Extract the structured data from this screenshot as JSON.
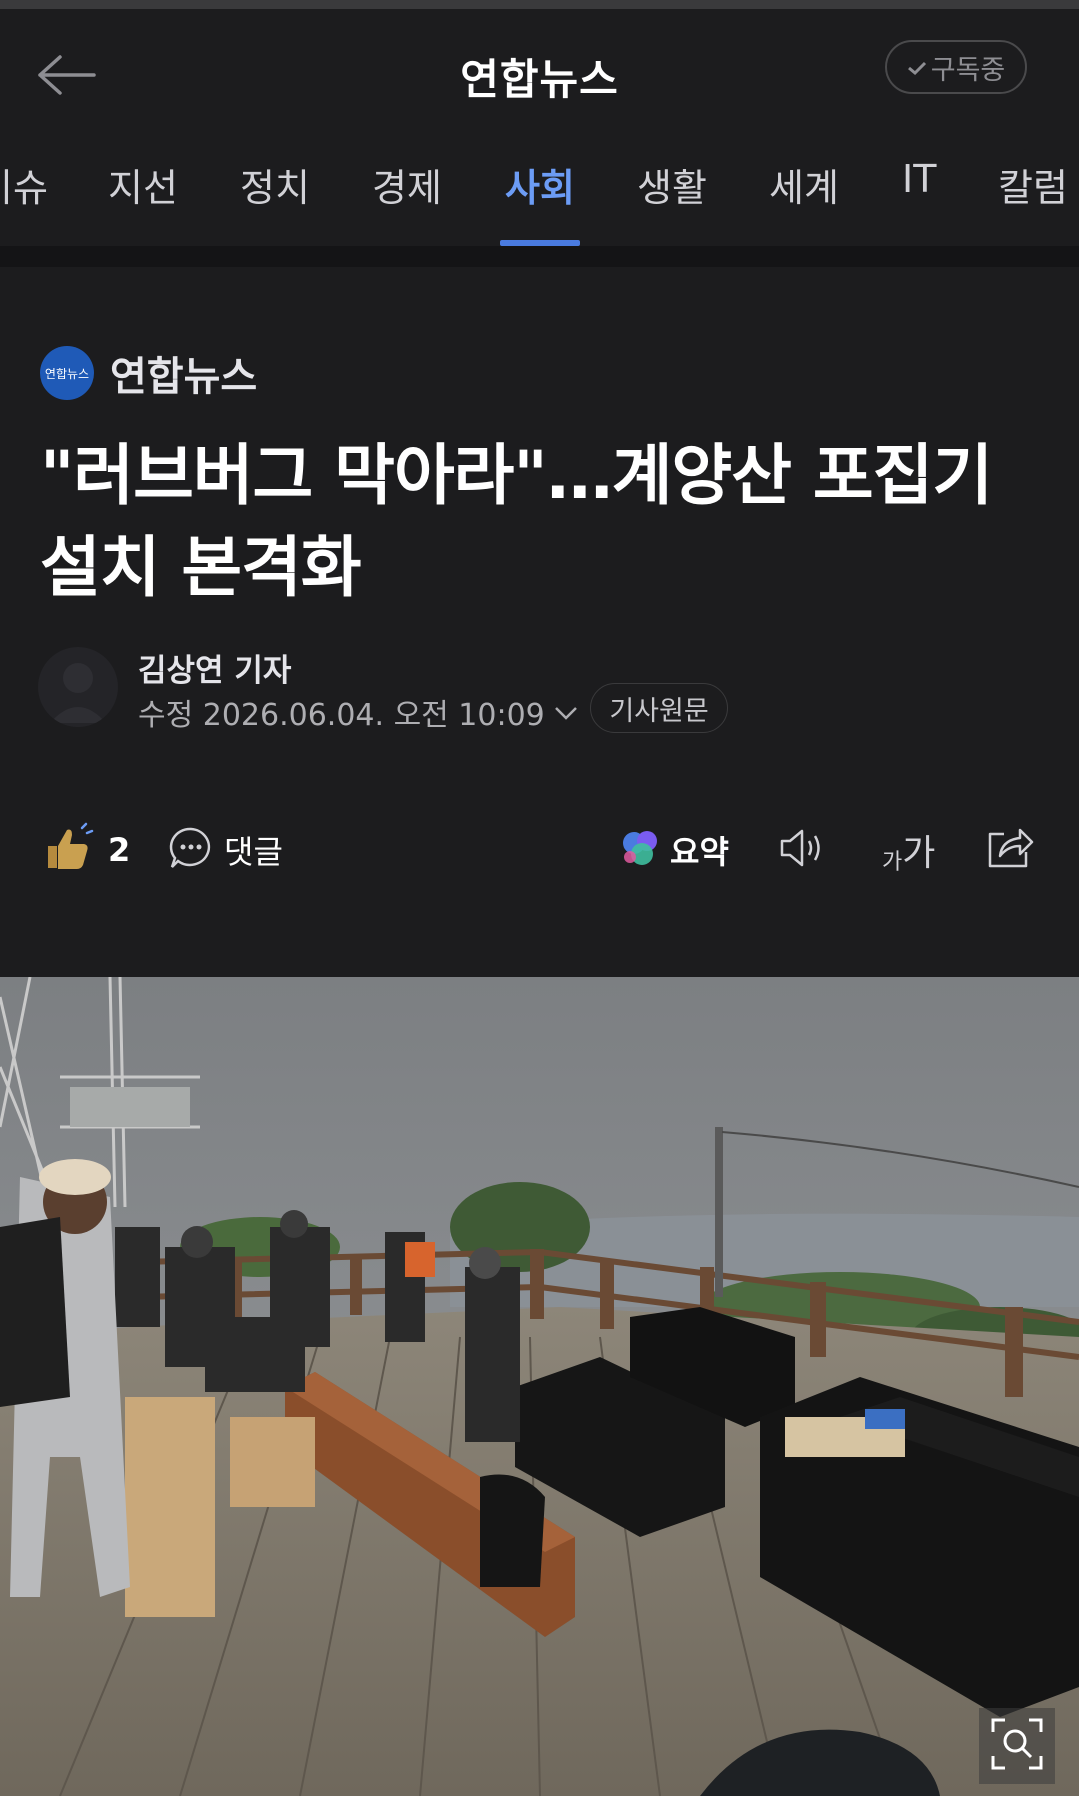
{
  "header": {
    "title": "연합뉴스",
    "subscribe_label": "구독중"
  },
  "tabs": [
    {
      "label": "이슈"
    },
    {
      "label": "지선"
    },
    {
      "label": "정치"
    },
    {
      "label": "경제"
    },
    {
      "label": "사회",
      "active": true
    },
    {
      "label": "생활"
    },
    {
      "label": "세계"
    },
    {
      "label": "IT"
    },
    {
      "label": "칼럼"
    }
  ],
  "article": {
    "publisher_logo_text": "연합뉴스",
    "publisher_name": "연합뉴스",
    "headline_line1": "\"러브버그 막아라\"…계양산 포집기",
    "headline_line2": "설치 본격화",
    "reporter": "김상연 기자",
    "date": "수정 2026.06.04. 오전 10:09",
    "original_label": "기사원문"
  },
  "actions": {
    "like_count": "2",
    "comment_label": "댓글",
    "summary_label": "요약",
    "font_small": "가",
    "font_large": "가"
  },
  "icons": {
    "back": "arrow-left-icon",
    "subscribe_check": "check-icon",
    "like": "thumbs-up-icon",
    "comment": "comment-bubble-icon",
    "summary": "ai-summary-icon",
    "audio": "speaker-icon",
    "font": "font-size-icon",
    "share": "share-icon",
    "zoom": "zoom-icon"
  },
  "colors": {
    "background": "#1c1c1e",
    "active_tab": "#6c9cf5",
    "tab_underline": "#4a7be0",
    "publisher_logo": "#1f5ab7",
    "like_icon": "#c9a050"
  }
}
